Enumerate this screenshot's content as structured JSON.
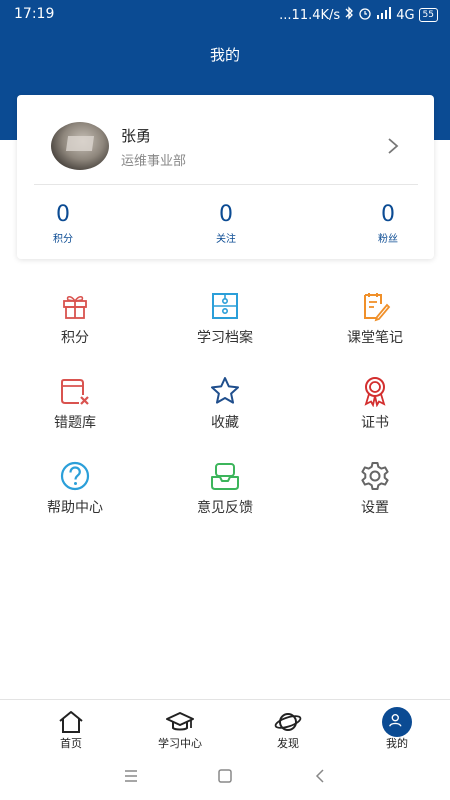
{
  "status_bar": {
    "time": "17:19",
    "net_speed": "...11.4K/s",
    "network": "4G",
    "battery": "55"
  },
  "header": {
    "title": "我的"
  },
  "profile": {
    "name": "张勇",
    "department": "运维事业部",
    "stats": [
      {
        "value": "0",
        "label": "积分"
      },
      {
        "value": "0",
        "label": "关注"
      },
      {
        "value": "0",
        "label": "粉丝"
      }
    ]
  },
  "menu": {
    "items": [
      {
        "label": "积分",
        "icon": "gift-icon",
        "color": "#d9534f"
      },
      {
        "label": "学习档案",
        "icon": "archive-icon",
        "color": "#2b9fd9"
      },
      {
        "label": "课堂笔记",
        "icon": "notes-icon",
        "color": "#f0902a"
      },
      {
        "label": "错题库",
        "icon": "wrong-questions-icon",
        "color": "#d9534f"
      },
      {
        "label": "收藏",
        "icon": "star-icon",
        "color": "#1f4e8c"
      },
      {
        "label": "证书",
        "icon": "certificate-icon",
        "color": "#d32f2f"
      },
      {
        "label": "帮助中心",
        "icon": "help-icon",
        "color": "#2b9fd9"
      },
      {
        "label": "意见反馈",
        "icon": "feedback-icon",
        "color": "#3cb55b"
      },
      {
        "label": "设置",
        "icon": "gear-icon",
        "color": "#666666"
      }
    ]
  },
  "tabbar": {
    "tabs": [
      {
        "label": "首页",
        "icon": "home-icon"
      },
      {
        "label": "学习中心",
        "icon": "graduation-cap-icon"
      },
      {
        "label": "发现",
        "icon": "planet-icon"
      },
      {
        "label": "我的",
        "icon": "user-icon",
        "active": true
      }
    ]
  },
  "colors": {
    "brand": "#0b4b93",
    "background": "#ffffff"
  }
}
